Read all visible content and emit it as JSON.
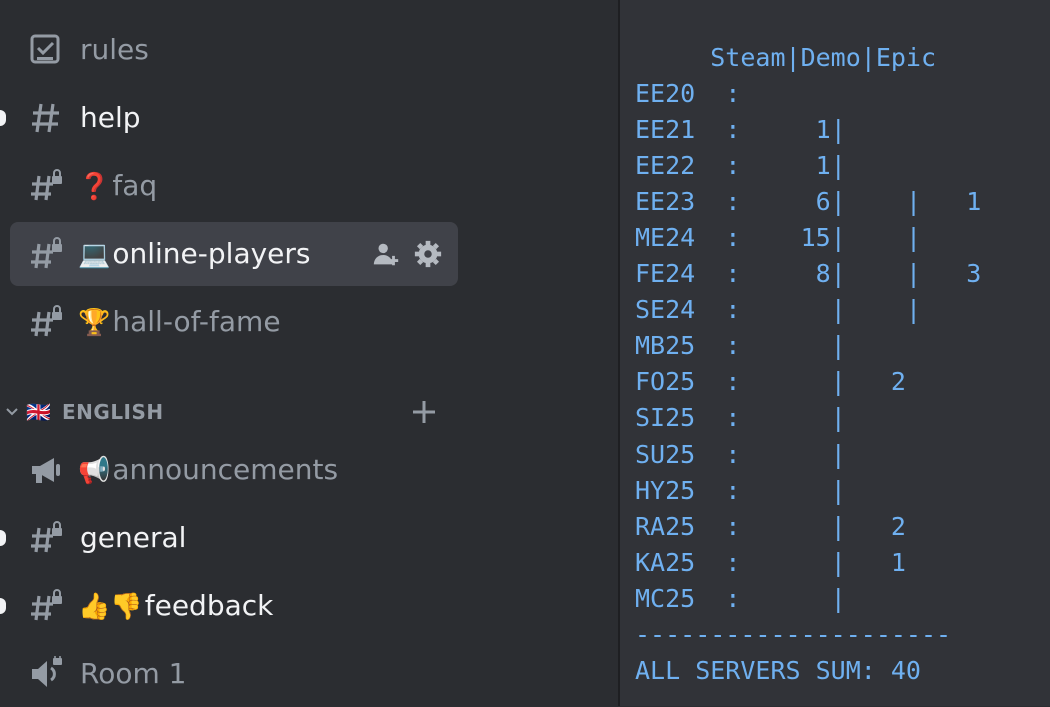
{
  "sidebar": {
    "channels": [
      {
        "icon": "rules-checkbox-icon",
        "emoji": "",
        "label": "rules",
        "state": "muted"
      },
      {
        "icon": "hashtag-icon",
        "emoji": "",
        "label": "help",
        "state": "bright",
        "unread": true
      },
      {
        "icon": "locked-hashtag-icon",
        "emoji": "❓",
        "label": "faq",
        "state": "muted"
      },
      {
        "icon": "locked-hashtag-icon",
        "emoji": "💻",
        "label": "online-players",
        "state": "selected"
      },
      {
        "icon": "locked-hashtag-icon",
        "emoji": "🏆",
        "label": "hall-of-fame",
        "state": "muted"
      }
    ],
    "category": {
      "flag": "🇬🇧",
      "label": "ENGLISH"
    },
    "english_channels": [
      {
        "icon": "announcement-icon",
        "emoji": "📢",
        "label": "announcements",
        "state": "muted"
      },
      {
        "icon": "locked-hashtag-icon",
        "emoji": "",
        "label": "general",
        "state": "bright",
        "unread": true
      },
      {
        "icon": "locked-hashtag-icon",
        "emoji": "👍👎",
        "label": "feedback",
        "state": "bright",
        "unread": true
      },
      {
        "icon": "voice-speaker-icon",
        "emoji": "",
        "label": "Room 1",
        "state": "muted"
      }
    ]
  },
  "message": {
    "header_line": "     Steam|Demo|Epic",
    "rows": [
      {
        "server": "EE20",
        "sep": ":",
        "steam": "",
        "demo": "",
        "epic": "",
        "pipes": 0
      },
      {
        "server": "EE21",
        "sep": ":",
        "steam": "1",
        "demo": "",
        "epic": "",
        "pipes": 1
      },
      {
        "server": "EE22",
        "sep": ":",
        "steam": "1",
        "demo": "",
        "epic": "",
        "pipes": 1
      },
      {
        "server": "EE23",
        "sep": ":",
        "steam": "6",
        "demo": "",
        "epic": "1",
        "pipes": 2
      },
      {
        "server": "ME24",
        "sep": ":",
        "steam": "15",
        "demo": "",
        "epic": "",
        "pipes": 2
      },
      {
        "server": "FE24",
        "sep": ":",
        "steam": "8",
        "demo": "",
        "epic": "3",
        "pipes": 2
      },
      {
        "server": "SE24",
        "sep": ":",
        "steam": "",
        "demo": "",
        "epic": "",
        "pipes": 2
      },
      {
        "server": "MB25",
        "sep": ":",
        "steam": "",
        "demo": "",
        "epic": "",
        "pipes": 1
      },
      {
        "server": "FO25",
        "sep": ":",
        "steam": "",
        "demo": "2",
        "epic": "",
        "pipes": 1
      },
      {
        "server": "SI25",
        "sep": ":",
        "steam": "",
        "demo": "",
        "epic": "",
        "pipes": 1
      },
      {
        "server": "SU25",
        "sep": ":",
        "steam": "",
        "demo": "",
        "epic": "",
        "pipes": 1
      },
      {
        "server": "HY25",
        "sep": ":",
        "steam": "",
        "demo": "",
        "epic": "",
        "pipes": 1
      },
      {
        "server": "RA25",
        "sep": ":",
        "steam": "",
        "demo": "2",
        "epic": "",
        "pipes": 1
      },
      {
        "server": "KA25",
        "sep": ":",
        "steam": "",
        "demo": "1",
        "epic": "",
        "pipes": 1
      },
      {
        "server": "MC25",
        "sep": ":",
        "steam": "",
        "demo": "",
        "epic": "",
        "pipes": 1
      }
    ],
    "rule": "---------------------",
    "total": "ALL SERVERS SUM: 40"
  },
  "colors": {
    "code_text": "#6fb0f0",
    "sidebar_bg": "#2b2d31",
    "chat_bg": "#313338",
    "selected_bg": "#404249"
  }
}
